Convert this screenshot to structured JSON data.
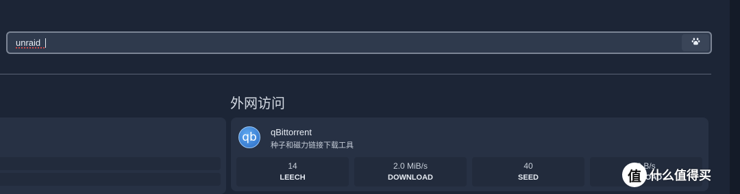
{
  "search": {
    "value": "unraid",
    "engine_icon": "baidu-paw-icon"
  },
  "section": {
    "title": "外网访问"
  },
  "app": {
    "icon_text": "qb",
    "name": "qBittorrent",
    "description": "种子和磁力链接下载工具",
    "stats": [
      {
        "value": "14",
        "label": "LEECH"
      },
      {
        "value": "2.0 MiB/s",
        "label": "DOWNLOAD"
      },
      {
        "value": "40",
        "label": "SEED"
      },
      {
        "value": "0 B/s",
        "label": "UPLOAD"
      }
    ]
  },
  "watermark": {
    "logo_text": "值",
    "text": "什么值得买"
  },
  "colors": {
    "background": "#1c2536",
    "card": "#273144",
    "stat_tile": "#222b3c",
    "search_border": "#7d8696",
    "app_icon": "#3b82d8"
  }
}
